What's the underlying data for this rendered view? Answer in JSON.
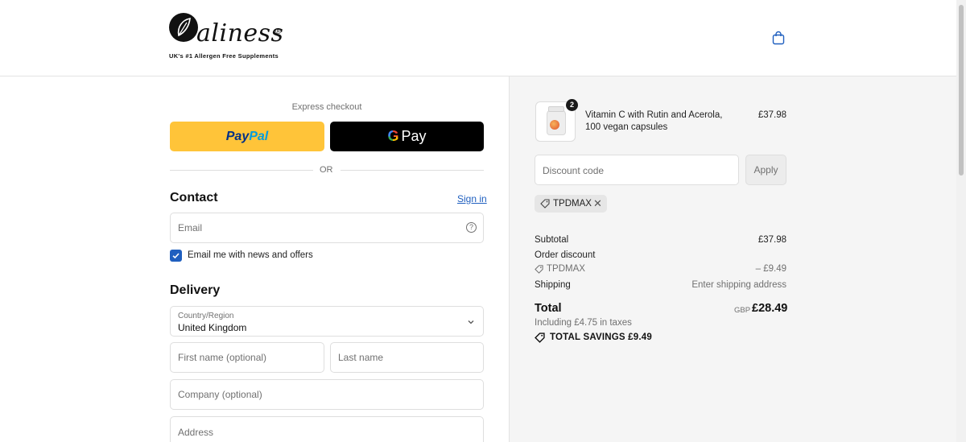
{
  "header": {
    "logo_word": "aliness",
    "logo_reg": "®",
    "logo_tagline": "UK's #1 Allergen Free Supplements",
    "icons": {
      "cart": "shopping-bag-icon"
    }
  },
  "express": {
    "label": "Express checkout",
    "paypal_part1": "Pay",
    "paypal_part2": "Pal",
    "gpay_g": "G",
    "gpay_text": "Pay",
    "divider": "OR"
  },
  "contact": {
    "title": "Contact",
    "sign_in": "Sign in",
    "email_placeholder": "Email",
    "newsletter_label": "Email me with news and offers",
    "newsletter_checked": true
  },
  "delivery": {
    "title": "Delivery",
    "country_label": "Country/Region",
    "country_value": "United Kingdom",
    "first_name_placeholder": "First name (optional)",
    "last_name_placeholder": "Last name",
    "company_placeholder": "Company (optional)",
    "address_placeholder": "Address"
  },
  "summary": {
    "item": {
      "name": "Vitamin C with Rutin and Acerola, 100 vegan capsules",
      "quantity": "2",
      "price": "£37.98"
    },
    "discount_placeholder": "Discount code",
    "apply_label": "Apply",
    "applied_code": "TPDMAX",
    "subtotal_label": "Subtotal",
    "subtotal_value": "£37.98",
    "order_discount_label": "Order discount",
    "discount_code": "TPDMAX",
    "discount_value": "– £9.49",
    "shipping_label": "Shipping",
    "shipping_value": "Enter shipping address",
    "total_label": "Total",
    "currency": "GBP",
    "total_value": "£28.49",
    "tax_line": "Including £4.75 in taxes",
    "savings_line": "TOTAL SAVINGS  £9.49"
  },
  "colors": {
    "paypal_yellow": "#ffc439",
    "link_blue": "#1f5fbf",
    "panel_bg": "#f5f5f5"
  }
}
